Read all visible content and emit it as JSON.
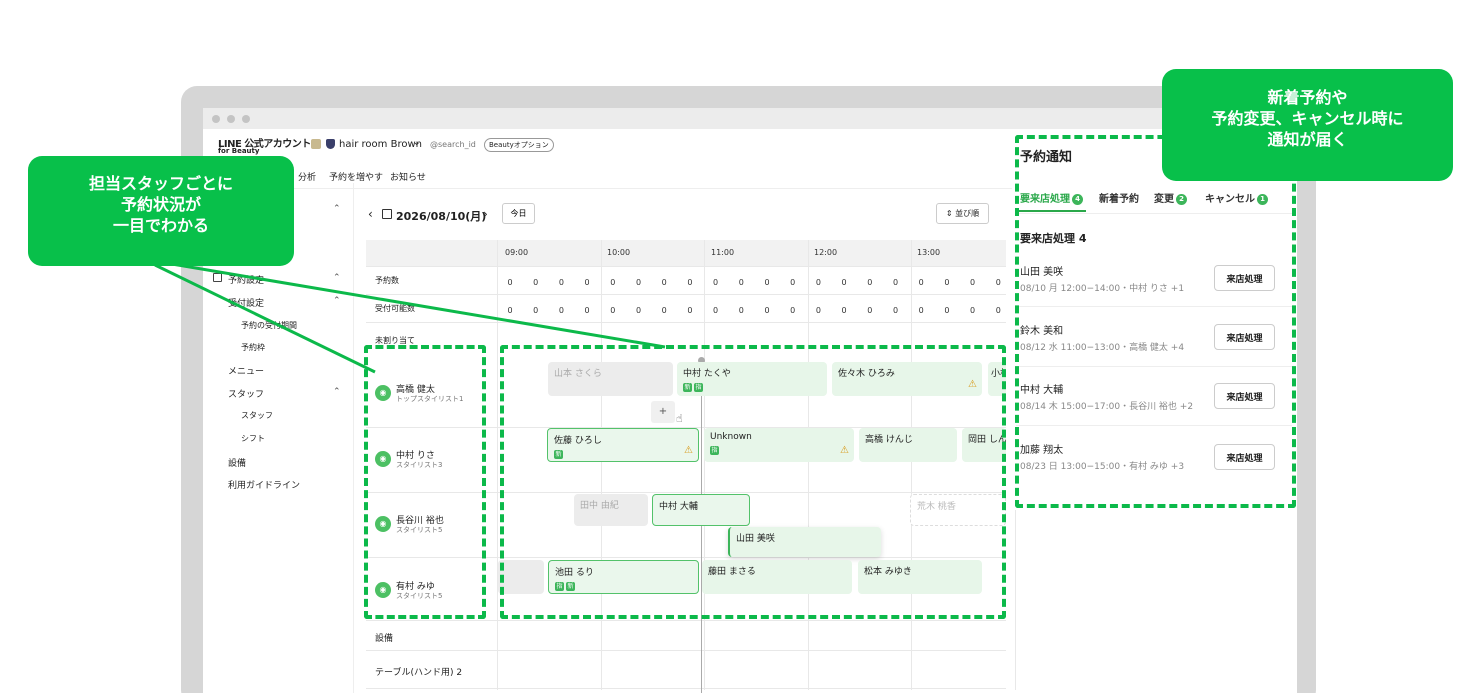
{
  "app": {
    "logo_line1": "LINE 公式アカウント",
    "logo_line2": "for Beauty",
    "account_name": "hair room Brown",
    "account_id": "@search_id",
    "plan_badge": "Beautyオプション",
    "chevron": "chevron-down-icon"
  },
  "nav": [
    "分析",
    "予約を増やす",
    "お知らせ"
  ],
  "sidebar": {
    "section": "予約設定",
    "items": [
      {
        "label": "受付設定",
        "level": 1,
        "expand": true
      },
      {
        "label": "予約の受付期間",
        "level": 2
      },
      {
        "label": "予約枠",
        "level": 2
      },
      {
        "label": "メニュー",
        "level": 1
      },
      {
        "label": "スタッフ",
        "level": 1,
        "expand": true
      },
      {
        "label": "スタッフ",
        "level": 2
      },
      {
        "label": "シフト",
        "level": 2
      },
      {
        "label": "設備",
        "level": 1
      },
      {
        "label": "利用ガイドライン",
        "level": 1
      }
    ]
  },
  "toolbar": {
    "date": "2026/08/10(月)",
    "today": "今日",
    "sort": "並び順"
  },
  "grid": {
    "hours": [
      "09:00",
      "10:00",
      "11:00",
      "12:00",
      "13:00"
    ],
    "row_labels": [
      "予約数",
      "受付可能数"
    ],
    "zero": "0",
    "unassigned": "未割り当て",
    "equipment": "設備",
    "equipment_row": "テーブル(ハンド用)",
    "equipment_count": "2"
  },
  "staff": [
    {
      "name": "高橋 健太",
      "role": "トップスタイリスト1"
    },
    {
      "name": "中村 りさ",
      "role": "スタイリスト3"
    },
    {
      "name": "長谷川 裕也",
      "role": "スタイリスト5"
    },
    {
      "name": "有村 みゆ",
      "role": "スタイリスト5"
    }
  ],
  "bookings": {
    "row1": [
      "山本 さくら",
      "中村 たくや",
      "佐々木 ひろみ",
      "小林"
    ],
    "row2": [
      "佐藤 ひろし",
      "Unknown",
      "高橋 けんじ",
      "岡田 しん"
    ],
    "row3": [
      "田中 由紀",
      "中村 大輔",
      "山田 美咲",
      "荒木 桃香"
    ],
    "row4": [
      "池田 るり",
      "藤田 まさる",
      "松本 みゆき"
    ],
    "tag_new": "新",
    "tag_designate": "指",
    "add": "+"
  },
  "panel": {
    "title": "予約通知",
    "tabs": [
      {
        "label": "要来店処理",
        "count": "4"
      },
      {
        "label": "新着予約",
        "count": ""
      },
      {
        "label": "変更",
        "count": "2"
      },
      {
        "label": "キャンセル",
        "count": "1"
      }
    ],
    "section_title": "要来店処理 4",
    "button": "来店処理",
    "items": [
      {
        "name": "山田 美咲",
        "detail": "08/10 月 12:00−14:00・中村 りさ +1"
      },
      {
        "name": "鈴木 美和",
        "detail": "08/12 水 11:00−13:00・高橋 健太 +4"
      },
      {
        "name": "中村 大輔",
        "detail": "08/14 木 15:00−17:00・長谷川 裕也 +2"
      },
      {
        "name": "加藤 翔太",
        "detail": "08/23 日 13:00−15:00・有村 みゆ +3"
      }
    ]
  },
  "callouts": {
    "left": [
      "担当スタッフごとに",
      "予約状況が",
      "一目でわかる"
    ],
    "right": [
      "新着予約や",
      "予約変更、キャンセル時に",
      "通知が届く"
    ]
  },
  "colors": {
    "accent": "#08c04a",
    "booking": "#e7f6e9",
    "tag": "#3cb55a"
  }
}
